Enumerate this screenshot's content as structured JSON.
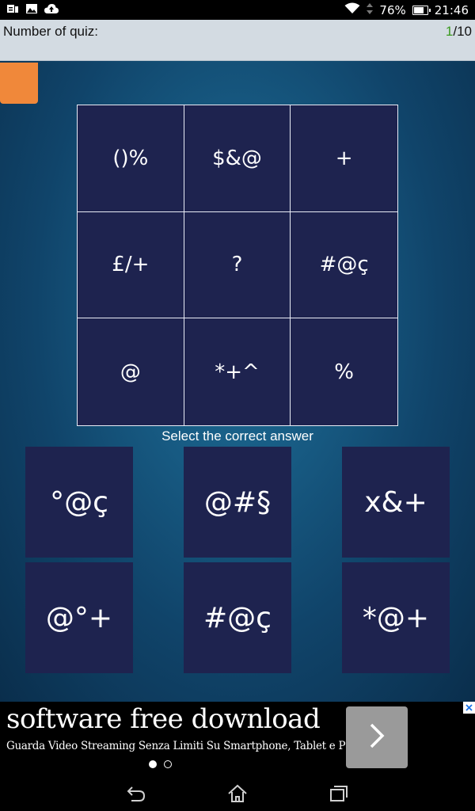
{
  "status_bar": {
    "battery": "76%",
    "time": "21:46",
    "icons": [
      "notification-icons",
      "gallery-icon",
      "cloud-upload-icon",
      "wifi-icon",
      "data-arrows-icon",
      "battery-icon"
    ]
  },
  "header": {
    "label": "Number of quiz:",
    "current": "1",
    "total": "/10"
  },
  "grid": {
    "cells": [
      "()%",
      "$&@",
      "+",
      "£/+",
      "?",
      "#@ç",
      "@",
      "*+^",
      "%"
    ]
  },
  "prompt": "Select the correct answer",
  "answers": [
    "°@ç",
    "@#§",
    "x&+",
    "@°+",
    "#@ç",
    "*@+"
  ],
  "ad": {
    "title": "software free download",
    "subtitle": "Guarda Video Streaming Senza Limiti Su Smartphone, Tablet e PC!",
    "button_icon": "chevron-right-icon",
    "close_icon": "close-icon"
  },
  "nav": {
    "icons": [
      "back-icon",
      "home-icon",
      "recents-icon"
    ]
  },
  "colors": {
    "cell_bg": "#1e234f",
    "accent_orange": "#f0883a",
    "counter_green": "#3a9a1e"
  }
}
